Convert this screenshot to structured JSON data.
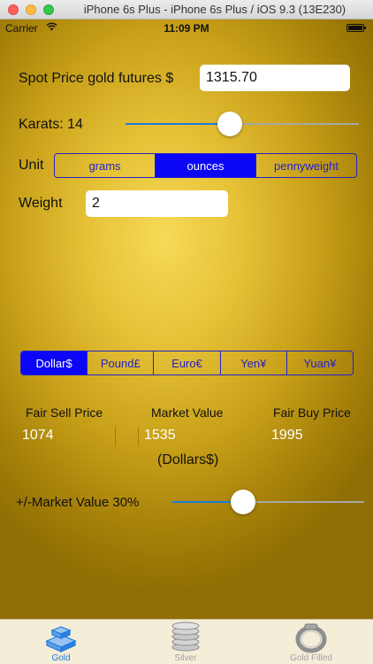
{
  "window": {
    "title": "iPhone 6s Plus - iPhone 6s Plus / iOS 9.3 (13E230)"
  },
  "status_bar": {
    "carrier": "Carrier",
    "time": "11:09 PM"
  },
  "spot_price": {
    "label": "Spot Price gold futures $",
    "value": "1315.70"
  },
  "karats": {
    "label": "Karats: 14",
    "slider_fraction": 0.44
  },
  "unit": {
    "label": "Unit",
    "options": [
      "grams",
      "ounces",
      "pennyweight"
    ],
    "selected": "ounces"
  },
  "weight": {
    "label": "Weight",
    "value": "2"
  },
  "currency": {
    "options": [
      "Dollar$",
      "Pound£",
      "Euro€",
      "Yen¥",
      "Yuan¥"
    ],
    "selected": "Dollar$"
  },
  "results": {
    "fair_sell_label": "Fair Sell Price",
    "fair_sell_value": "1074",
    "market_label": "Market Value",
    "market_value": "1535",
    "market_unit": "(Dollars$)",
    "fair_buy_label": "Fair Buy Price",
    "fair_buy_value": "1995"
  },
  "market_margin": {
    "label": "+/-Market Value 30%",
    "slider_fraction": 0.35
  },
  "tabs": [
    {
      "label": "Gold",
      "icon": "gold-bars-icon",
      "active": true
    },
    {
      "label": "Silver",
      "icon": "silver-coins-icon",
      "active": false
    },
    {
      "label": "Gold Filled",
      "icon": "ring-icon",
      "active": false
    }
  ],
  "colors": {
    "accent": "#1e7adf",
    "segment_selected": "#0b07f6",
    "segment_border": "#2323c8"
  }
}
